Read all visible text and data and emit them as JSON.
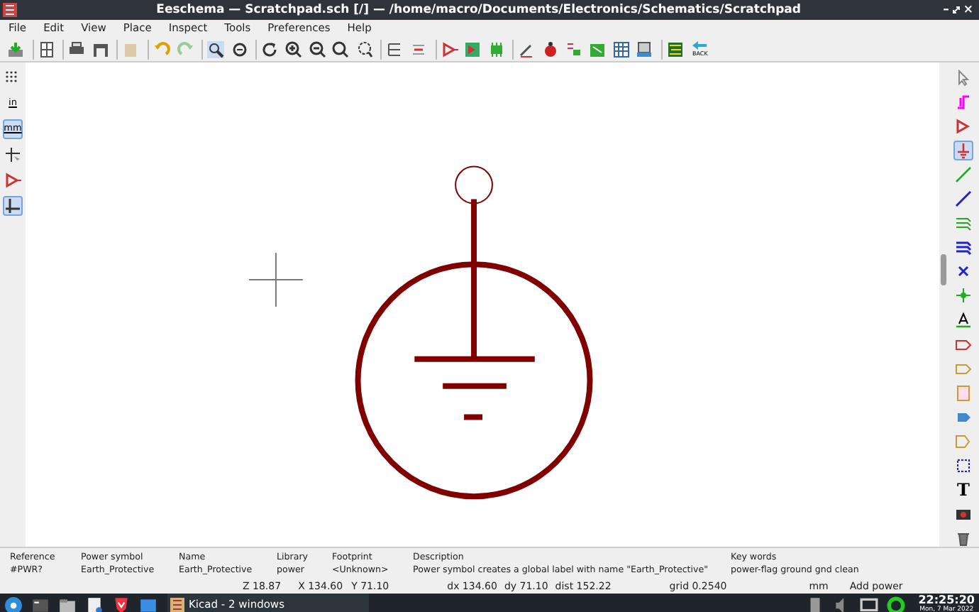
{
  "window": {
    "title": "Eeschema — Scratchpad.sch [/] — /home/macro/Documents/Electronics/Schematics/Scratchpad"
  },
  "window_controls": {
    "minimize": "–",
    "close": "×"
  },
  "menu": [
    "File",
    "Edit",
    "View",
    "Place",
    "Inspect",
    "Tools",
    "Preferences",
    "Help"
  ],
  "left_toolbar": [
    {
      "selected": false
    },
    {
      "selected": false
    },
    {
      "selected": true
    },
    {
      "selected": false
    },
    {
      "selected": false
    },
    {
      "selected": true
    }
  ],
  "left_toolbar_labels": {
    "inches": "in",
    "millimetres": "mm"
  },
  "right_toolbar": [
    {
      "selected": false
    },
    {
      "selected": false
    },
    {
      "selected": false
    },
    {
      "selected": true
    },
    {
      "selected": false
    },
    {
      "selected": false
    },
    {
      "selected": false
    },
    {
      "selected": false
    },
    {
      "selected": false
    },
    {
      "selected": false
    },
    {
      "selected": false
    },
    {
      "selected": false
    },
    {
      "selected": false
    },
    {
      "selected": false
    },
    {
      "selected": false
    },
    {
      "selected": false
    },
    {
      "selected": false
    },
    {
      "selected": false
    },
    {
      "selected": false
    },
    {
      "selected": false
    }
  ],
  "right_toolbar_text": "T",
  "back_label": "BACK",
  "info_panel": [
    {
      "label": "Reference",
      "value": "#PWR?"
    },
    {
      "label": "Power symbol",
      "value": "Earth_Protective"
    },
    {
      "label": "Name",
      "value": "Earth_Protective"
    },
    {
      "label": "Library",
      "value": "power"
    },
    {
      "label": "Footprint",
      "value": "<Unknown>"
    },
    {
      "label": "Description",
      "value": "Power symbol creates a global label with name \"Earth_Protective\""
    },
    {
      "label": "Key words",
      "value": "power-flag ground gnd clean"
    }
  ],
  "status_bar": {
    "zoom": "Z 18.87",
    "x": "X 134.60",
    "y": "Y 71.10",
    "dx": "dx 134.60",
    "dy": "dy 71.10",
    "dist": "dist 152.22",
    "grid": "grid 0.2540",
    "units": "mm",
    "action": "Add power"
  },
  "taskbar": {
    "window_button": "Kicad - 2 windows",
    "time": "22:25:20",
    "date": "Mon, 7 Mar 2022"
  }
}
